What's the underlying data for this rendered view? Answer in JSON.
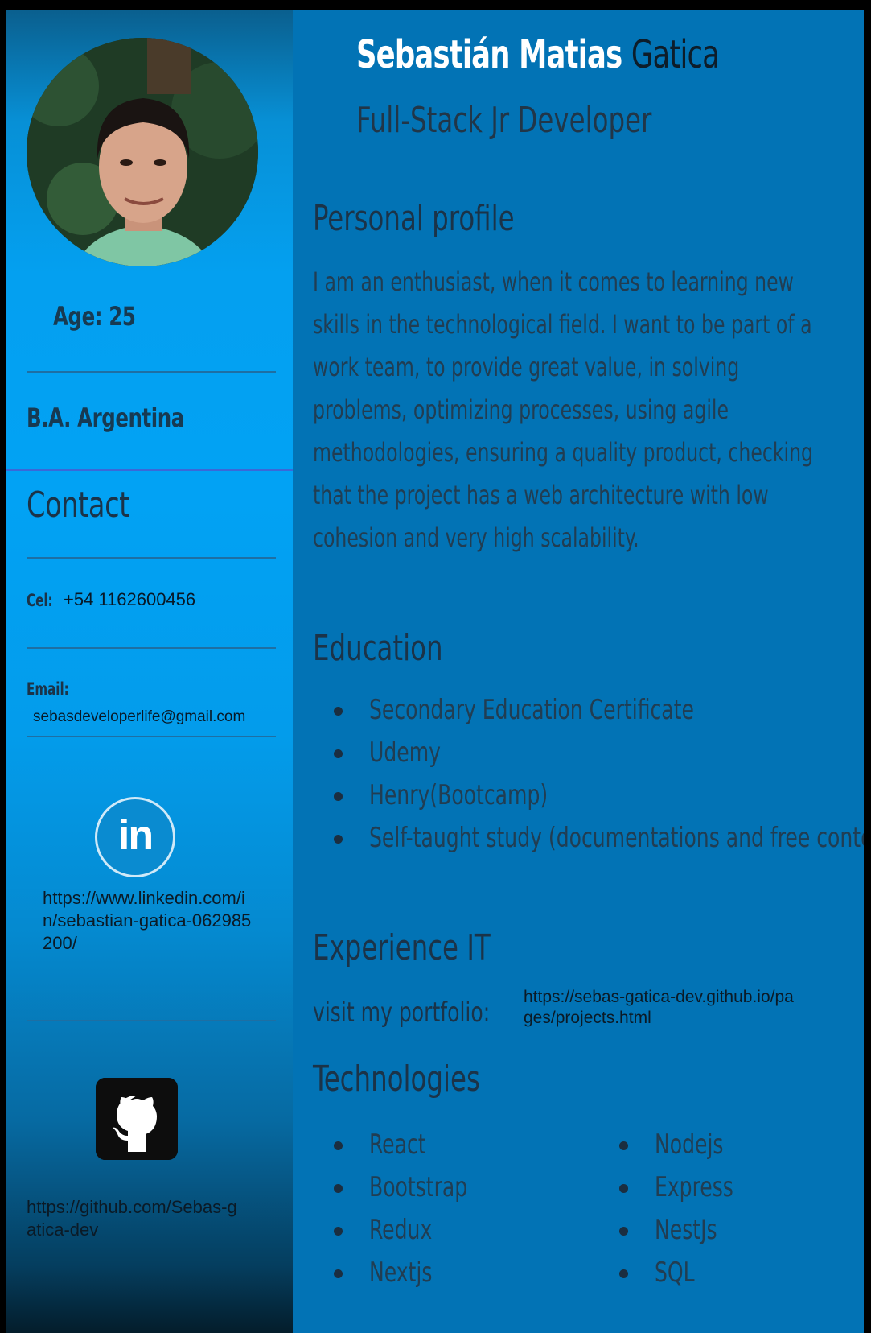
{
  "sidebar": {
    "age": "Age: 25",
    "location": "B.A. Argentina",
    "contact_title": "Contact",
    "cel_label": "Cel:",
    "cel_value": "+54 1162600456",
    "email_label": "Email:",
    "email_value": "sebasdeveloperlife@gmail.com",
    "linkedin_icon_text": "in",
    "linkedin_url": "https://www.linkedin.com/in/sebastian-gatica-062985200/",
    "github_url": "https://github.com/Sebas-gatica-dev"
  },
  "header": {
    "first_names": "Sebastián Matias",
    "last_name": "Gatica",
    "role": "Full-Stack Jr Developer"
  },
  "profile": {
    "title": "Personal profile",
    "text": "I am an enthusiast, when it comes to learning new skills in the technological field. I want to be part of a work team, to provide great value, in solving problems, optimizing processes, using agile methodologies, ensuring a quality product, checking that the project has a web architecture with low cohesion and very high scalability."
  },
  "education": {
    "title": "Education",
    "items": [
      "Secondary Education Certificate",
      "Udemy",
      "Henry(Bootcamp)",
      "Self-taught study (documentations and free content)"
    ]
  },
  "experience": {
    "title": "Experience IT",
    "portfolio_label": "visit my portfolio:",
    "portfolio_url": "https://sebas-gatica-dev.github.io/pages/projects.html"
  },
  "technologies": {
    "title": "Technologies",
    "col1": [
      "React",
      "Bootstrap",
      "Redux",
      "Nextjs"
    ],
    "col2": [
      "Nodejs",
      "Express",
      "NestJs",
      "SQL"
    ]
  },
  "icons": {
    "linkedin": "linkedin-icon",
    "github": "github-icon"
  },
  "colors": {
    "main_bg": "#0273b5",
    "sidebar_accent": "#02a2f4",
    "name_highlight": "#ffffff"
  }
}
